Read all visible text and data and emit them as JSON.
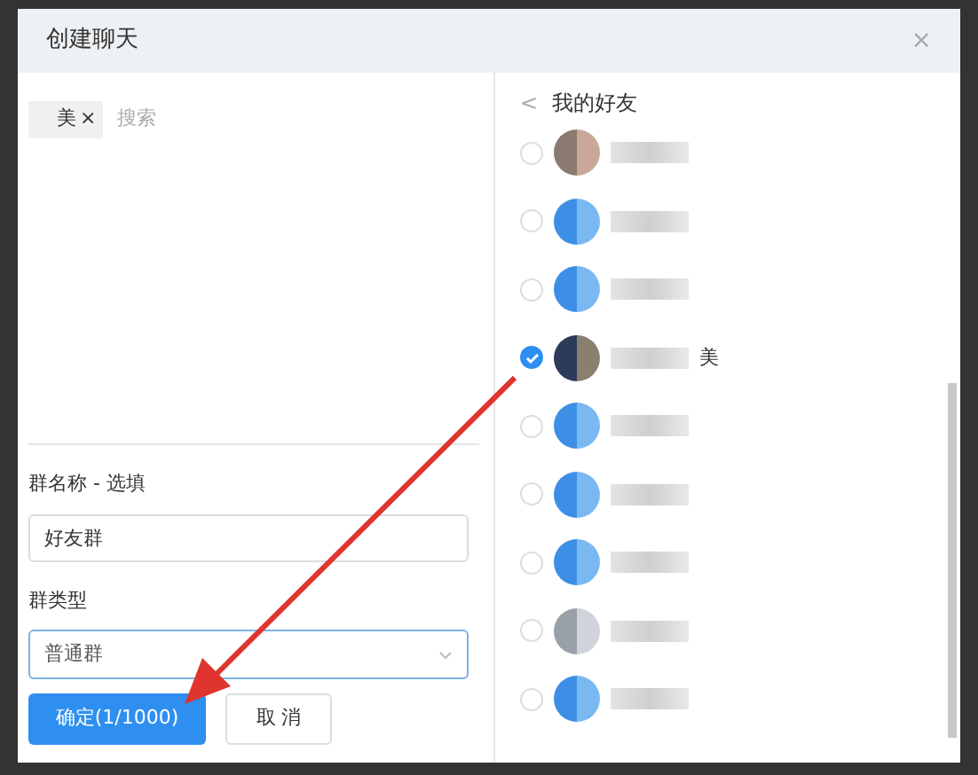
{
  "window": {
    "title": "创建聊天",
    "close": "×"
  },
  "left": {
    "chips": [
      {
        "text": "美",
        "remove": "×"
      }
    ],
    "search": {
      "placeholder": "搜索"
    },
    "group_name": {
      "label": "群名称 - 选填",
      "value": "好友群"
    },
    "group_type": {
      "label": "群类型",
      "value": "普通群"
    },
    "buttons": [
      {
        "kind": "primary",
        "label": "确定(1/1000)"
      },
      {
        "kind": "secondary",
        "label": "取 消"
      }
    ]
  },
  "right": {
    "back": "<",
    "title": "我的好友",
    "friends": [
      {
        "kind": "photo",
        "selected": false
      },
      {
        "kind": "blue",
        "selected": false
      },
      {
        "kind": "blue",
        "selected": false
      },
      {
        "kind": "dark",
        "name": "美",
        "selected": true
      },
      {
        "kind": "blue",
        "selected": false
      },
      {
        "kind": "blue",
        "selected": false
      },
      {
        "kind": "blue",
        "selected": false
      },
      {
        "kind": "grey",
        "selected": false
      },
      {
        "kind": "blue",
        "selected": false
      }
    ]
  }
}
